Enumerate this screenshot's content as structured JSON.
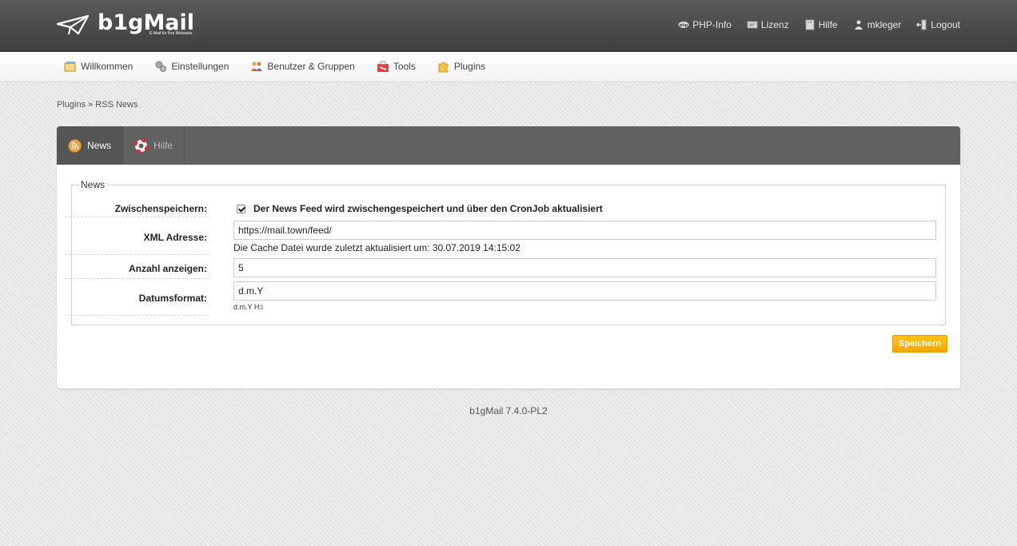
{
  "app": {
    "logo_text": "b1gMail",
    "logo_sub": "E-Mail für Ihre Webseite"
  },
  "toplinks": [
    {
      "label": "PHP-Info",
      "icon": "php-icon"
    },
    {
      "label": "Lizenz",
      "icon": "license-icon"
    },
    {
      "label": "Hilfe",
      "icon": "help-book-icon"
    },
    {
      "label": "mkleger",
      "icon": "user-icon"
    },
    {
      "label": "Logout",
      "icon": "logout-icon"
    }
  ],
  "nav": [
    {
      "label": "Willkommen",
      "icon": "welcome-icon"
    },
    {
      "label": "Einstellungen",
      "icon": "gears-icon"
    },
    {
      "label": "Benutzer & Gruppen",
      "icon": "users-icon"
    },
    {
      "label": "Tools",
      "icon": "tools-icon"
    },
    {
      "label": "Plugins",
      "icon": "puzzle-icon"
    }
  ],
  "breadcrumb": "Plugins » RSS News",
  "tabs": [
    {
      "label": "News",
      "icon": "rss-icon",
      "active": true
    },
    {
      "label": "Hilfe",
      "icon": "lifebuoy-icon",
      "active": false
    }
  ],
  "form": {
    "legend": "News",
    "cache": {
      "label": "Zwischenspeichern:",
      "checked": true,
      "text": "Der News Feed wird zwischengespeichert und über den CronJob aktualisiert"
    },
    "xml": {
      "label": "XML Adresse:",
      "value": "https://mail.town/feed/",
      "note": "Die Cache Datei wurde zuletzt aktualisiert um: 30.07.2019 14:15:02"
    },
    "count": {
      "label": "Anzahl anzeigen:",
      "value": "5"
    },
    "dateformat": {
      "label": "Datumsformat:",
      "value": "d.m.Y",
      "hint": "d.m.Y H:i"
    },
    "save_label": "Speichern"
  },
  "footer": "b1gMail 7.4.0-PL2",
  "colors": {
    "accent": "#f4a800",
    "header": "#4a4a4a",
    "tabbar": "#616161"
  }
}
